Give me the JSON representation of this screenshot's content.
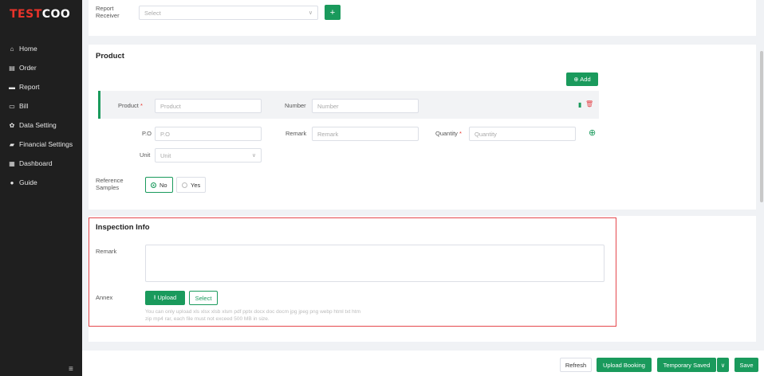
{
  "brand": {
    "logo_test": "TEST",
    "logo_coo": "COO"
  },
  "sidebar": {
    "items": [
      {
        "label": "Home",
        "icon": "home-icon",
        "glyph": "⌂"
      },
      {
        "label": "Order",
        "icon": "order-icon",
        "glyph": "▤"
      },
      {
        "label": "Report",
        "icon": "report-icon",
        "glyph": "▬"
      },
      {
        "label": "Bill",
        "icon": "bill-icon",
        "glyph": "▭"
      },
      {
        "label": "Data Setting",
        "icon": "gear-icon",
        "glyph": "✿"
      },
      {
        "label": "Financial Settings",
        "icon": "folder-icon",
        "glyph": "▰"
      },
      {
        "label": "Dashboard",
        "icon": "dashboard-icon",
        "glyph": "▦"
      },
      {
        "label": "Guide",
        "icon": "info-icon",
        "glyph": "●"
      }
    ],
    "toggle_glyph": "≡"
  },
  "report_receiver": {
    "label_line1": "Report",
    "label_line2": "Receiver",
    "placeholder": "Select",
    "add_glyph": "+"
  },
  "product": {
    "title": "Product",
    "add_label": "⊕ Add",
    "product_label": "Product",
    "product_placeholder": "Product",
    "number_label": "Number",
    "number_placeholder": "Number",
    "po_label": "P.O",
    "po_placeholder": "P.O",
    "remark_label": "Remark",
    "remark_placeholder": "Remark",
    "quantity_label": "Quantity",
    "quantity_placeholder": "Quantity",
    "unit_label": "Unit",
    "unit_placeholder": "Unit",
    "required_mark": "*",
    "copy_glyph": "▮",
    "delete_glyph": "🗑",
    "plus_circle_glyph": "⊕"
  },
  "reference_samples": {
    "label_line1": "Reference",
    "label_line2": "Samples",
    "options": [
      "No",
      "Yes"
    ],
    "selected": "No"
  },
  "inspection": {
    "title": "Inspection Info",
    "remark_label": "Remark",
    "annex_label": "Annex",
    "upload_label": "⭱ Upload",
    "select_label": "Select",
    "hint_line1": "You can only upload xls xlsx xlsb xlsm pdf pptx docx doc docm jpg jpeg png webp html txt htm",
    "hint_line2": "zip mp4 rar, each file must not exceed 500 MB in size."
  },
  "footer": {
    "refresh": "Refresh",
    "upload_booking": "Upload Booking",
    "temporary_saved": "Temporary Saved",
    "dropdown_glyph": "∨",
    "save": "Save"
  },
  "colors": {
    "accent": "#1a9a5c",
    "danger": "#e5484d",
    "sidebar": "#1f1f1f"
  }
}
